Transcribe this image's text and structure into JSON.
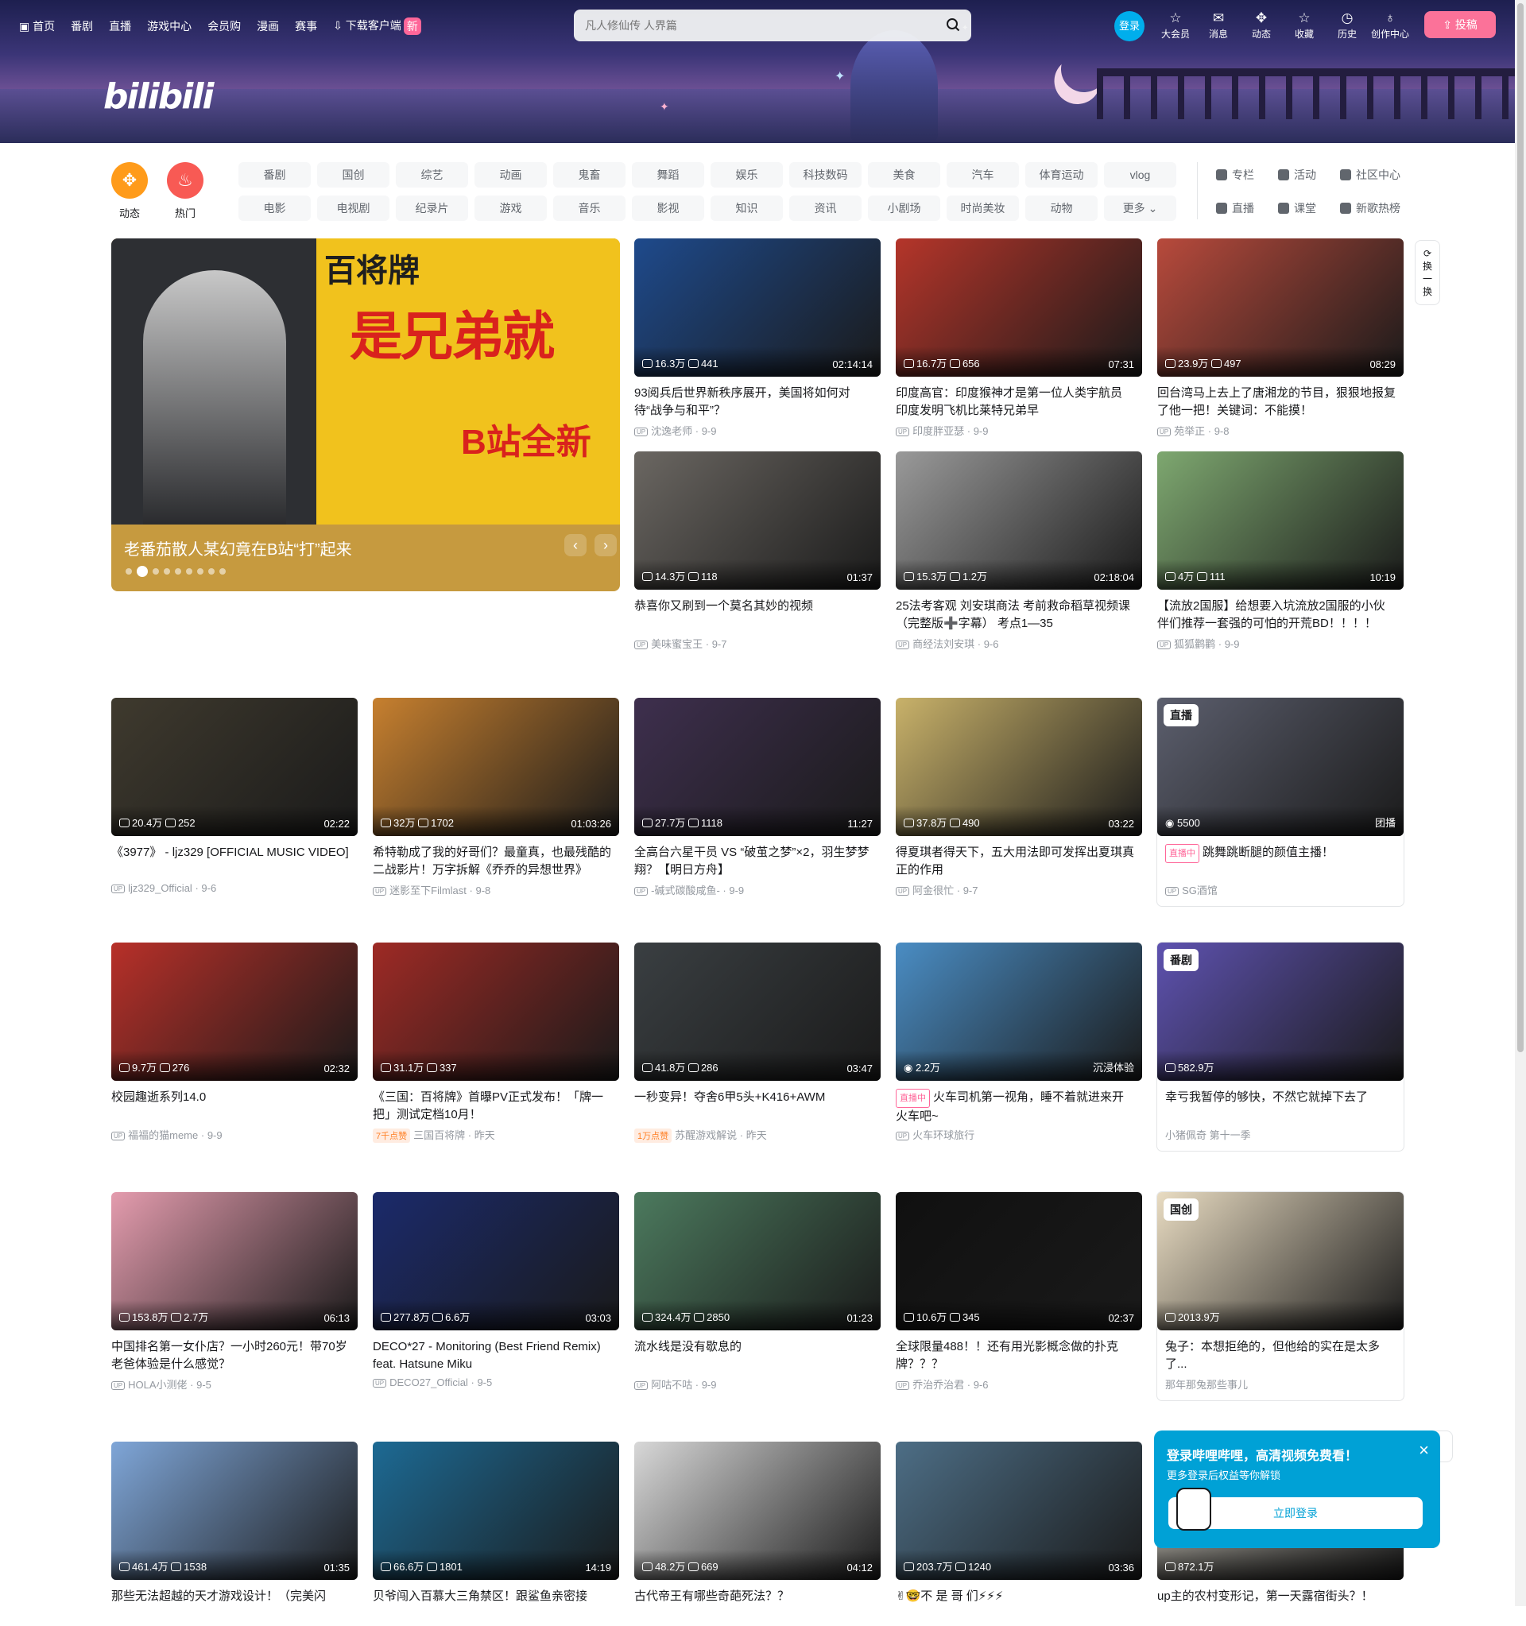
{
  "nav": {
    "items": [
      "首页",
      "番剧",
      "直播",
      "游戏中心",
      "会员购",
      "漫画",
      "赛事",
      "下载客户端"
    ],
    "new_badge": "新",
    "search_placeholder": "凡人修仙传 人界篇",
    "login": "登录",
    "right": [
      "大会员",
      "消息",
      "动态",
      "收藏",
      "历史",
      "创作中心"
    ],
    "upload": "投稿"
  },
  "banner": {
    "logo": "bilibili"
  },
  "quick": [
    {
      "label": "动态",
      "color": "#ff9b1a"
    },
    {
      "label": "热门",
      "color": "#f85a54"
    }
  ],
  "chips": [
    "番剧",
    "国创",
    "综艺",
    "动画",
    "鬼畜",
    "舞蹈",
    "娱乐",
    "科技数码",
    "美食",
    "汽车",
    "体育运动",
    "vlog",
    "电影",
    "电视剧",
    "纪录片",
    "游戏",
    "音乐",
    "影视",
    "知识",
    "资讯",
    "小剧场",
    "时尚美妆",
    "动物",
    "更多"
  ],
  "links": [
    "专栏",
    "活动",
    "社区中心",
    "直播",
    "课堂",
    "新歌热榜"
  ],
  "carousel": {
    "title": "老番茄散人某幻竟在B站“打”起来",
    "header": "百将牌",
    "big": "是兄弟就",
    "sub": "B站全新"
  },
  "refresh": [
    "换",
    "一",
    "换"
  ],
  "videos": [
    {
      "plays": "16.3万",
      "danmaku": "441",
      "dur": "02:14:14",
      "title": "93阅兵后世界新秩序展开，美国将如何对待“战争与和平”？",
      "up": "沈逸老师",
      "date": "9-9",
      "bg": "#1e4a8c"
    },
    {
      "plays": "16.7万",
      "danmaku": "656",
      "dur": "07:31",
      "title": "印度高官：印度猴神才是第一位人类宇航员 印度发明飞机比莱特兄弟早",
      "up": "印度胖亚瑟",
      "date": "9-9",
      "bg": "#b5352a"
    },
    {
      "plays": "23.9万",
      "danmaku": "497",
      "dur": "08:29",
      "title": "回台湾马上去上了唐湘龙的节目，狠狠地报复了他一把！关键词：不能摸！",
      "up": "苑举正",
      "date": "9-8",
      "bg": "#b84a3c"
    },
    {
      "plays": "14.3万",
      "danmaku": "118",
      "dur": "01:37",
      "title": "恭喜你又刷到一个莫名其妙的视频",
      "up": "美味蜜宝王",
      "date": "9-7",
      "bg": "#6b6762"
    },
    {
      "plays": "15.3万",
      "danmaku": "1.2万",
      "dur": "02:18:04",
      "title": "25法考客观 刘安琪商法 考前救命稻草视频课（完整版➕字幕） 考点1—35",
      "up": "商经法刘安琪",
      "date": "9-6",
      "bg": "#9a9a9a"
    },
    {
      "plays": "4万",
      "danmaku": "111",
      "dur": "10:19",
      "title": "【流放2国服】给想要入坑流放2国服的小伙伴们推荐一套强的可怕的开荒BD！！！！",
      "up": "狐狐鹳鹳",
      "date": "9-9",
      "bg": "#7ea870"
    },
    {
      "plays": "20.4万",
      "danmaku": "252",
      "dur": "02:22",
      "title": "《3977》 - ljz329 [OFFICIAL MUSIC VIDEO]",
      "up": "ljz329_Official",
      "date": "9-6",
      "bg": "#3f3a2e"
    },
    {
      "plays": "32万",
      "danmaku": "1702",
      "dur": "01:03:26",
      "title": "希特勒成了我的好哥们？最童真，也最残酷的二战影片！万字拆解《乔乔的异想世界》",
      "up": "迷影至下Filmlast",
      "date": "9-8",
      "bg": "#c7802f"
    },
    {
      "plays": "27.7万",
      "danmaku": "1118",
      "dur": "11:27",
      "title": "全高台六星干员 VS “破茧之梦”×2，羽生梦梦翔？【明日方舟】",
      "up": "-碱式碳酸咸鱼-",
      "date": "9-9",
      "bg": "#3e2f4e"
    },
    {
      "plays": "37.8万",
      "danmaku": "490",
      "dur": "03:22",
      "title": "得夏琪者得天下，五大用法即可发挥出夏琪真正的作用",
      "up": "阿金很忙",
      "date": "9-7",
      "bg": "#c9b26a"
    },
    {
      "live": true,
      "tag": "直播",
      "viewers": "5500",
      "area": "团播",
      "livepill": "直播中",
      "title": "跳舞跳断腿的颜值主播！",
      "up": "SG酒馆",
      "bg": "#5c5f6e"
    },
    {
      "plays": "9.7万",
      "danmaku": "276",
      "dur": "02:32",
      "title": "校园趣逝系列14.0",
      "up": "福福的猫meme",
      "date": "9-9",
      "bg": "#b83029"
    },
    {
      "plays": "31.1万",
      "danmaku": "337",
      "dur": "",
      "title": "《三国：百将牌》首曝PV正式发布！「牌一把」测试定档10月！",
      "pill": "7千点赞",
      "up": "三国百将牌",
      "date": "昨天",
      "bg": "#9e2a25"
    },
    {
      "plays": "41.8万",
      "danmaku": "286",
      "dur": "03:47",
      "title": "一秒变异！夺舍6甲5头+K416+AWM",
      "pill": "1万点赞",
      "up": "苏醒游戏解说",
      "date": "昨天",
      "bg": "#3a3f42"
    },
    {
      "live2": true,
      "viewers": "2.2万",
      "area": "沉浸体验",
      "livepill": "直播中",
      "title": "火车司机第一视角，睡不着就进来开火车吧~",
      "up": "火车环球旅行",
      "bg": "#4a8dc4"
    },
    {
      "ban": true,
      "tag": "番剧",
      "plays": "582.9万",
      "title": "幸亏我暂停的够快，不然它就掉下去了",
      "sub": "小猪佩奇 第十一季",
      "bg": "#5e52b0"
    },
    {
      "plays": "153.8万",
      "danmaku": "2.7万",
      "dur": "06:13",
      "title": "中国排名第一女仆店？一小时260元！带70岁老爸体验是什么感觉？",
      "up": "HOLA小测佬",
      "date": "9-5",
      "bg": "#e49cae"
    },
    {
      "plays": "277.8万",
      "danmaku": "6.6万",
      "dur": "03:03",
      "title": "DECO*27 - Monitoring (Best Friend Remix) feat. Hatsune Miku",
      "up": "DECO27_Official",
      "date": "9-5",
      "bg": "#1b2a6b"
    },
    {
      "plays": "324.4万",
      "danmaku": "2850",
      "dur": "01:23",
      "title": "流水线是没有歇息的",
      "up": "阿咕不咕",
      "date": "9-9",
      "bg": "#4c7a5e"
    },
    {
      "plays": "10.6万",
      "danmaku": "345",
      "dur": "02:37",
      "title": "全球限量488！！还有用光影概念做的扑克牌？？？",
      "up": "乔治乔治君",
      "date": "9-6",
      "bg": "#101010"
    },
    {
      "ban": true,
      "tag": "国创",
      "plays": "2013.9万",
      "title": "兔子：本想拒绝的，但他给的实在是太多了...",
      "sub": "那年那兔那些事儿",
      "bg": "#e9dcc2"
    },
    {
      "plays": "461.4万",
      "danmaku": "1538",
      "dur": "01:35",
      "title": "那些无法超越的天才游戏设计！（完美闪",
      "up": "",
      "date": "",
      "bg": "#7fa6d8"
    },
    {
      "plays": "66.6万",
      "danmaku": "1801",
      "dur": "14:19",
      "title": "贝爷闯入百慕大三角禁区！跟鲨鱼亲密接",
      "up": "",
      "date": "",
      "bg": "#1d6a94"
    },
    {
      "plays": "48.2万",
      "danmaku": "669",
      "dur": "04:12",
      "title": "古代帝王有哪些奇葩死法？？",
      "up": "",
      "date": "",
      "bg": "#d8d8d8"
    },
    {
      "plays": "203.7万",
      "danmaku": "1240",
      "dur": "03:36",
      "title": "✌🤓不 是 哥 们⚡⚡⚡",
      "up": "",
      "date": "",
      "bg": "#4d6e86"
    },
    {
      "plays": "872.1万",
      "danmaku": "",
      "dur": "",
      "title": "up主的农村变形记，第一天露宿街头？！",
      "up": "",
      "date": "",
      "bg": "#a6a39a"
    }
  ],
  "popup": {
    "title": "登录哔哩哔哩，高清视频免费看！",
    "sub": "更多登录后权益等你解锁",
    "btn": "立即登录",
    "close": "×"
  }
}
